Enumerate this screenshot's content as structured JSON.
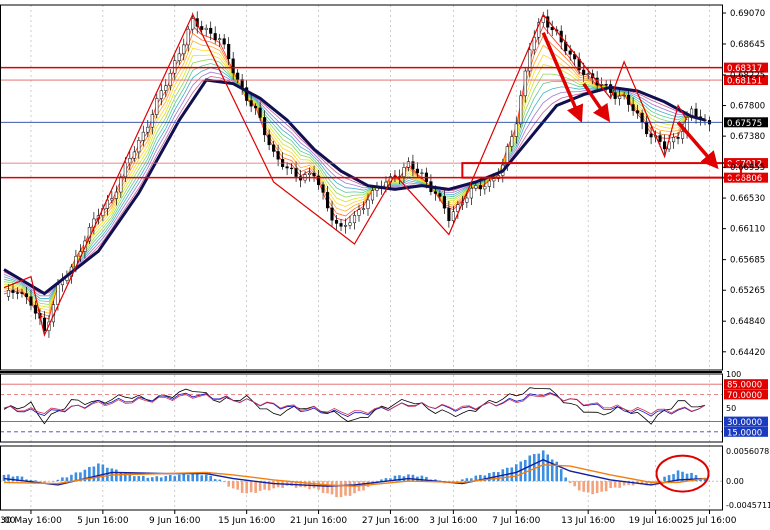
{
  "chart_data": [
    {
      "type": "candlestick",
      "panel": "price",
      "x_tick_labels": [
        "30 May 16:00",
        "5 Jun 16:00",
        "9 Jun 16:00",
        "15 Jun 16:00",
        "21 Jun 16:00",
        "27 Jun 16:00",
        "3 Jul 16:00",
        "7 Jul 16:00",
        "13 Jul 16:00",
        "19 Jul 16:00",
        "25 Jul 16:00"
      ],
      "x_left_partial_label": ":00",
      "y_ticks": [
        0.6907,
        0.68645,
        0.6822,
        0.678,
        0.6738,
        0.66953,
        0.6653,
        0.6611,
        0.65685,
        0.65265,
        0.6484,
        0.6442
      ],
      "y_tick_labels": [
        "0.69070",
        "0.68645",
        "0.68225",
        "0.67800",
        "0.67380",
        "0.66955",
        "0.66530",
        "0.66110",
        "0.65685",
        "0.65265",
        "0.64840",
        "0.64420"
      ],
      "ylim": [
        0.6417,
        0.6918
      ],
      "levels": {
        "resistance_upper": 0.6832,
        "resistance_lower": 0.6815,
        "support_upper": 0.6701,
        "support_lower": 0.6681,
        "current_price": 0.6757
      },
      "level_labels": [
        "0.68317",
        "0.68151",
        "0.67575",
        "0.67012",
        "0.66806"
      ],
      "close_path": [
        [
          0,
          0.6515
        ],
        [
          3,
          0.653
        ],
        [
          6,
          0.6507
        ],
        [
          9,
          0.647
        ],
        [
          12,
          0.653
        ],
        [
          15,
          0.6555
        ],
        [
          18,
          0.66
        ],
        [
          21,
          0.663
        ],
        [
          24,
          0.6655
        ],
        [
          27,
          0.6695
        ],
        [
          30,
          0.673
        ],
        [
          33,
          0.677
        ],
        [
          36,
          0.681
        ],
        [
          39,
          0.6855
        ],
        [
          42,
          0.6893
        ],
        [
          45,
          0.6885
        ],
        [
          48,
          0.687
        ],
        [
          51,
          0.683
        ],
        [
          54,
          0.679
        ],
        [
          57,
          0.676
        ],
        [
          60,
          0.6715
        ],
        [
          63,
          0.669
        ],
        [
          66,
          0.6684
        ],
        [
          69,
          0.6685
        ],
        [
          72,
          0.664
        ],
        [
          75,
          0.661
        ],
        [
          78,
          0.6625
        ],
        [
          81,
          0.6655
        ],
        [
          84,
          0.6668
        ],
        [
          87,
          0.6685
        ],
        [
          90,
          0.6697
        ],
        [
          93,
          0.6685
        ],
        [
          96,
          0.666
        ],
        [
          99,
          0.6625
        ],
        [
          102,
          0.6652
        ],
        [
          105,
          0.6665
        ],
        [
          108,
          0.6675
        ],
        [
          111,
          0.6695
        ],
        [
          114,
          0.676
        ],
        [
          117,
          0.686
        ],
        [
          120,
          0.69
        ],
        [
          123,
          0.688
        ],
        [
          126,
          0.6845
        ],
        [
          129,
          0.6828
        ],
        [
          132,
          0.681
        ],
        [
          135,
          0.68
        ],
        [
          138,
          0.679
        ],
        [
          141,
          0.6765
        ],
        [
          144,
          0.674
        ],
        [
          147,
          0.6722
        ],
        [
          150,
          0.674
        ],
        [
          153,
          0.677
        ],
        [
          156,
          0.6757
        ]
      ],
      "zigzag": [
        [
          0,
          0.653
        ],
        [
          6,
          0.6545
        ],
        [
          9,
          0.6465
        ],
        [
          42,
          0.6905
        ],
        [
          60,
          0.6675
        ],
        [
          78,
          0.659
        ],
        [
          87,
          0.6685
        ],
        [
          99,
          0.6603
        ],
        [
          120,
          0.6905
        ],
        [
          135,
          0.679
        ],
        [
          138,
          0.684
        ],
        [
          147,
          0.671
        ],
        [
          150,
          0.678
        ],
        [
          152,
          0.676
        ]
      ],
      "ma_slow": [
        [
          0,
          0.6555
        ],
        [
          9,
          0.6522
        ],
        [
          21,
          0.658
        ],
        [
          30,
          0.666
        ],
        [
          39,
          0.676
        ],
        [
          45,
          0.6815
        ],
        [
          51,
          0.681
        ],
        [
          57,
          0.679
        ],
        [
          63,
          0.676
        ],
        [
          69,
          0.672
        ],
        [
          75,
          0.669
        ],
        [
          81,
          0.667
        ],
        [
          87,
          0.6665
        ],
        [
          93,
          0.667
        ],
        [
          99,
          0.6665
        ],
        [
          105,
          0.6675
        ],
        [
          111,
          0.669
        ],
        [
          117,
          0.6735
        ],
        [
          123,
          0.678
        ],
        [
          129,
          0.6795
        ],
        [
          135,
          0.6805
        ],
        [
          141,
          0.68
        ],
        [
          147,
          0.6785
        ],
        [
          153,
          0.6765
        ],
        [
          156,
          0.676
        ]
      ],
      "annotations": [
        {
          "type": "arrow",
          "from": [
            120,
            0.688
          ],
          "to": [
            128,
            0.6765
          ]
        },
        {
          "type": "arrow",
          "from": [
            129,
            0.681
          ],
          "to": [
            134,
            0.6765
          ]
        },
        {
          "type": "arrow",
          "from": [
            150,
            0.6757
          ],
          "to": [
            158,
            0.67
          ]
        },
        {
          "type": "rectangle",
          "x": [
            102,
            164
          ],
          "y": [
            0.6681,
            0.6701
          ]
        }
      ]
    },
    {
      "type": "line",
      "panel": "oscillator",
      "ylim": [
        0,
        100
      ],
      "levels": [
        85,
        70,
        30,
        15
      ],
      "level_labels": [
        "85.0000",
        "70.0000",
        "30.0000",
        "15.0000"
      ],
      "y_tick_labels": [
        "100",
        "50"
      ],
      "series": [
        {
          "color": "#000000",
          "values": [
            [
              0,
              48
            ],
            [
              6,
              55
            ],
            [
              9,
              30
            ],
            [
              15,
              60
            ],
            [
              21,
              58
            ],
            [
              27,
              68
            ],
            [
              33,
              62
            ],
            [
              39,
              72
            ],
            [
              42,
              78
            ],
            [
              48,
              60
            ],
            [
              54,
              65
            ],
            [
              60,
              40
            ],
            [
              66,
              52
            ],
            [
              72,
              45
            ],
            [
              78,
              30
            ],
            [
              84,
              50
            ],
            [
              90,
              62
            ],
            [
              96,
              45
            ],
            [
              102,
              40
            ],
            [
              108,
              58
            ],
            [
              114,
              70
            ],
            [
              120,
              82
            ],
            [
              126,
              55
            ],
            [
              132,
              40
            ],
            [
              138,
              50
            ],
            [
              144,
              30
            ],
            [
              150,
              60
            ],
            [
              156,
              50
            ]
          ]
        },
        {
          "color": "#1010c0",
          "values": [
            [
              0,
              50
            ],
            [
              9,
              42
            ],
            [
              21,
              58
            ],
            [
              33,
              64
            ],
            [
              42,
              70
            ],
            [
              54,
              60
            ],
            [
              66,
              48
            ],
            [
              78,
              40
            ],
            [
              90,
              56
            ],
            [
              102,
              48
            ],
            [
              114,
              62
            ],
            [
              120,
              72
            ],
            [
              132,
              52
            ],
            [
              144,
              42
            ],
            [
              156,
              50
            ]
          ]
        },
        {
          "color": "#d03050",
          "values": [
            [
              0,
              50
            ],
            [
              9,
              45
            ],
            [
              21,
              56
            ],
            [
              33,
              62
            ],
            [
              42,
              68
            ],
            [
              54,
              60
            ],
            [
              66,
              50
            ],
            [
              78,
              43
            ],
            [
              90,
              55
            ],
            [
              102,
              50
            ],
            [
              114,
              60
            ],
            [
              120,
              70
            ],
            [
              132,
              54
            ],
            [
              144,
              45
            ],
            [
              156,
              50
            ]
          ]
        }
      ]
    },
    {
      "type": "bar",
      "panel": "histogram",
      "y_tick_labels": [
        "0.0056078",
        "0.00",
        "-0.0045711"
      ],
      "ylim": [
        -0.0046,
        0.0056
      ],
      "values": [
        [
          0,
          0.001
        ],
        [
          3,
          0.0008
        ],
        [
          6,
          0.0002
        ],
        [
          9,
          -0.0004
        ],
        [
          12,
          0.0002
        ],
        [
          15,
          0.001
        ],
        [
          18,
          0.0018
        ],
        [
          21,
          0.0028
        ],
        [
          24,
          0.002
        ],
        [
          27,
          0.0012
        ],
        [
          30,
          0.0008
        ],
        [
          33,
          0.0006
        ],
        [
          36,
          0.0008
        ],
        [
          39,
          0.001
        ],
        [
          42,
          0.0012
        ],
        [
          45,
          0.001
        ],
        [
          48,
          0.0002
        ],
        [
          51,
          -0.0012
        ],
        [
          54,
          -0.002
        ],
        [
          57,
          -0.0016
        ],
        [
          60,
          -0.0012
        ],
        [
          63,
          -0.0008
        ],
        [
          66,
          -0.001
        ],
        [
          69,
          -0.0012
        ],
        [
          72,
          -0.002
        ],
        [
          75,
          -0.0026
        ],
        [
          78,
          -0.002
        ],
        [
          81,
          -0.001
        ],
        [
          84,
          0.0002
        ],
        [
          87,
          0.0008
        ],
        [
          90,
          0.001
        ],
        [
          93,
          0.0008
        ],
        [
          96,
          0.0002
        ],
        [
          99,
          -0.0004
        ],
        [
          102,
          0.0002
        ],
        [
          105,
          0.0008
        ],
        [
          108,
          0.0012
        ],
        [
          111,
          0.0018
        ],
        [
          114,
          0.0026
        ],
        [
          117,
          0.004
        ],
        [
          120,
          0.0048
        ],
        [
          123,
          0.003
        ],
        [
          126,
          -0.0004
        ],
        [
          129,
          -0.0018
        ],
        [
          132,
          -0.002
        ],
        [
          135,
          -0.0012
        ],
        [
          138,
          -0.0008
        ],
        [
          141,
          -0.0004
        ],
        [
          144,
          -0.0006
        ],
        [
          147,
          0.0006
        ],
        [
          150,
          0.0016
        ],
        [
          153,
          0.0012
        ],
        [
          156,
          0.0004
        ]
      ],
      "signal_lines": [
        {
          "color": "#1020a0",
          "values": [
            [
              0,
              0.0004
            ],
            [
              12,
              -0.0006
            ],
            [
              24,
              0.0014
            ],
            [
              36,
              0.0012
            ],
            [
              45,
              0.0012
            ],
            [
              51,
              0.0004
            ],
            [
              60,
              -0.0004
            ],
            [
              72,
              -0.0008
            ],
            [
              78,
              -0.0006
            ],
            [
              90,
              0.0004
            ],
            [
              102,
              -0.0004
            ],
            [
              114,
              0.0014
            ],
            [
              120,
              0.0034
            ],
            [
              126,
              0.0016
            ],
            [
              135,
              0.0002
            ],
            [
              144,
              -0.0006
            ],
            [
              150,
              0.0002
            ],
            [
              156,
              0.0004
            ]
          ]
        },
        {
          "color": "#f08010",
          "values": [
            [
              0,
              -0.0002
            ],
            [
              12,
              -0.0004
            ],
            [
              24,
              0.001
            ],
            [
              36,
              0.0012
            ],
            [
              45,
              0.0014
            ],
            [
              51,
              0.001
            ],
            [
              60,
              0.0002
            ],
            [
              72,
              -0.0006
            ],
            [
              78,
              -0.0008
            ],
            [
              90,
              0.0
            ],
            [
              102,
              -0.0002
            ],
            [
              114,
              0.0008
            ],
            [
              120,
              0.0026
            ],
            [
              126,
              0.0024
            ],
            [
              135,
              0.001
            ],
            [
              144,
              -0.0002
            ],
            [
              150,
              -0.0002
            ],
            [
              156,
              0.0004
            ]
          ]
        }
      ],
      "annotations": [
        {
          "type": "ellipse",
          "center_x": 151
        }
      ]
    }
  ]
}
